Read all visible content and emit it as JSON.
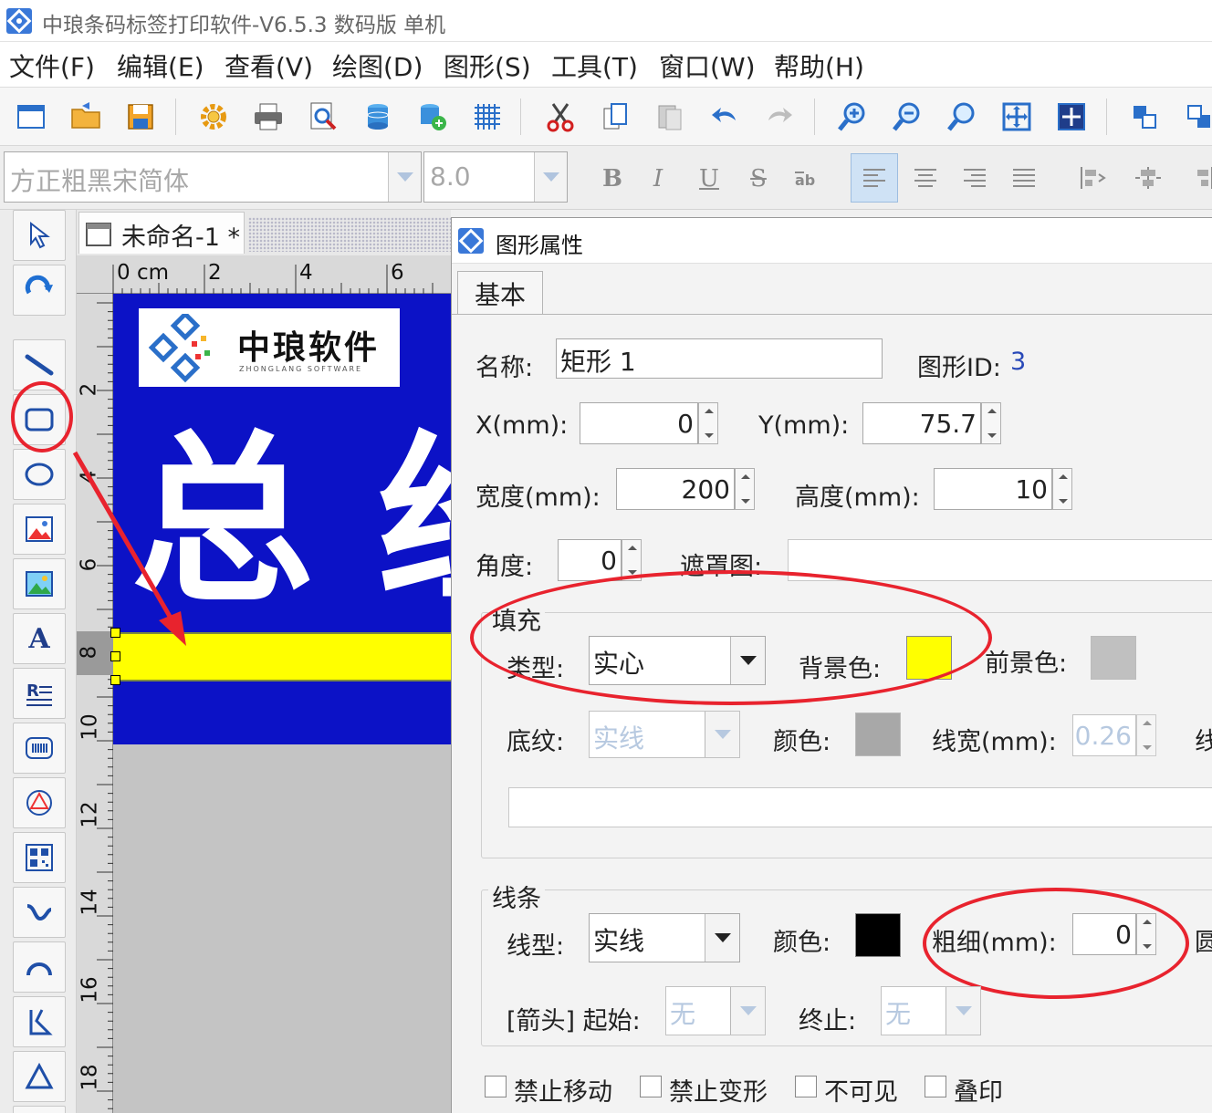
{
  "window": {
    "title": "中琅条码标签打印软件-V6.5.3 数码版 单机"
  },
  "menu": [
    "文件(F)",
    "编辑(E)",
    "查看(V)",
    "绘图(D)",
    "图形(S)",
    "工具(T)",
    "窗口(W)",
    "帮助(H)"
  ],
  "fontbar": {
    "font": "方正粗黑宋简体",
    "size": "8.0",
    "bold": "B",
    "italic": "I",
    "underline": "U",
    "strike": "S"
  },
  "document": {
    "tab_label": "未命名-1 *",
    "hruler_labels": [
      "0 cm",
      "2",
      "4",
      "6"
    ],
    "vruler_labels": [
      "2",
      "4",
      "6",
      "8",
      "10",
      "12",
      "14",
      "16",
      "18"
    ],
    "logo_name": "中琅软件",
    "logo_subtitle": "ZHONGLANG SOFTWARE",
    "canvas_chars": [
      "总",
      "经"
    ]
  },
  "dialog": {
    "title": "图形属性",
    "tab": "基本",
    "name_label": "名称:",
    "name_value": "矩形 1",
    "shape_id_label": "图形ID:",
    "shape_id_value": "3",
    "x_label": "X(mm):",
    "x_value": "0",
    "y_label": "Y(mm):",
    "y_value": "75.7",
    "width_label": "宽度(mm):",
    "width_value": "200",
    "height_label": "高度(mm):",
    "height_value": "10",
    "angle_label": "角度:",
    "angle_value": "0",
    "mask_label": "遮罩图:",
    "fill": {
      "group_title": "填充",
      "type_label": "类型:",
      "type_value": "实心",
      "bg_label": "背景色:",
      "bg_color": "#ffff00",
      "fg_label": "前景色:",
      "fg_color": "#c0c0c0",
      "pattern_label": "底纹:",
      "pattern_value": "实线",
      "color_label": "颜色:",
      "color_value": "#a8a8a8",
      "linewidth_label": "线宽(mm):",
      "linewidth_value": "0.26",
      "cut_label": "线"
    },
    "line": {
      "group_title": "线条",
      "type_label": "线型:",
      "type_value": "实线",
      "color_label": "颜色:",
      "color_value": "#000000",
      "thickness_label": "粗细(mm):",
      "thickness_value": "0",
      "cut_label": "圆",
      "arrow_start_label": "[箭头] 起始:",
      "arrow_start_value": "无",
      "arrow_end_label": "终止:",
      "arrow_end_value": "无"
    },
    "checkboxes": [
      "禁止移动",
      "禁止变形",
      "不可见",
      "叠印"
    ]
  },
  "colors": {
    "label_blue": "#0c12c6",
    "highlight_yellow": "#ffff00",
    "annotation_red": "#e8232e"
  }
}
